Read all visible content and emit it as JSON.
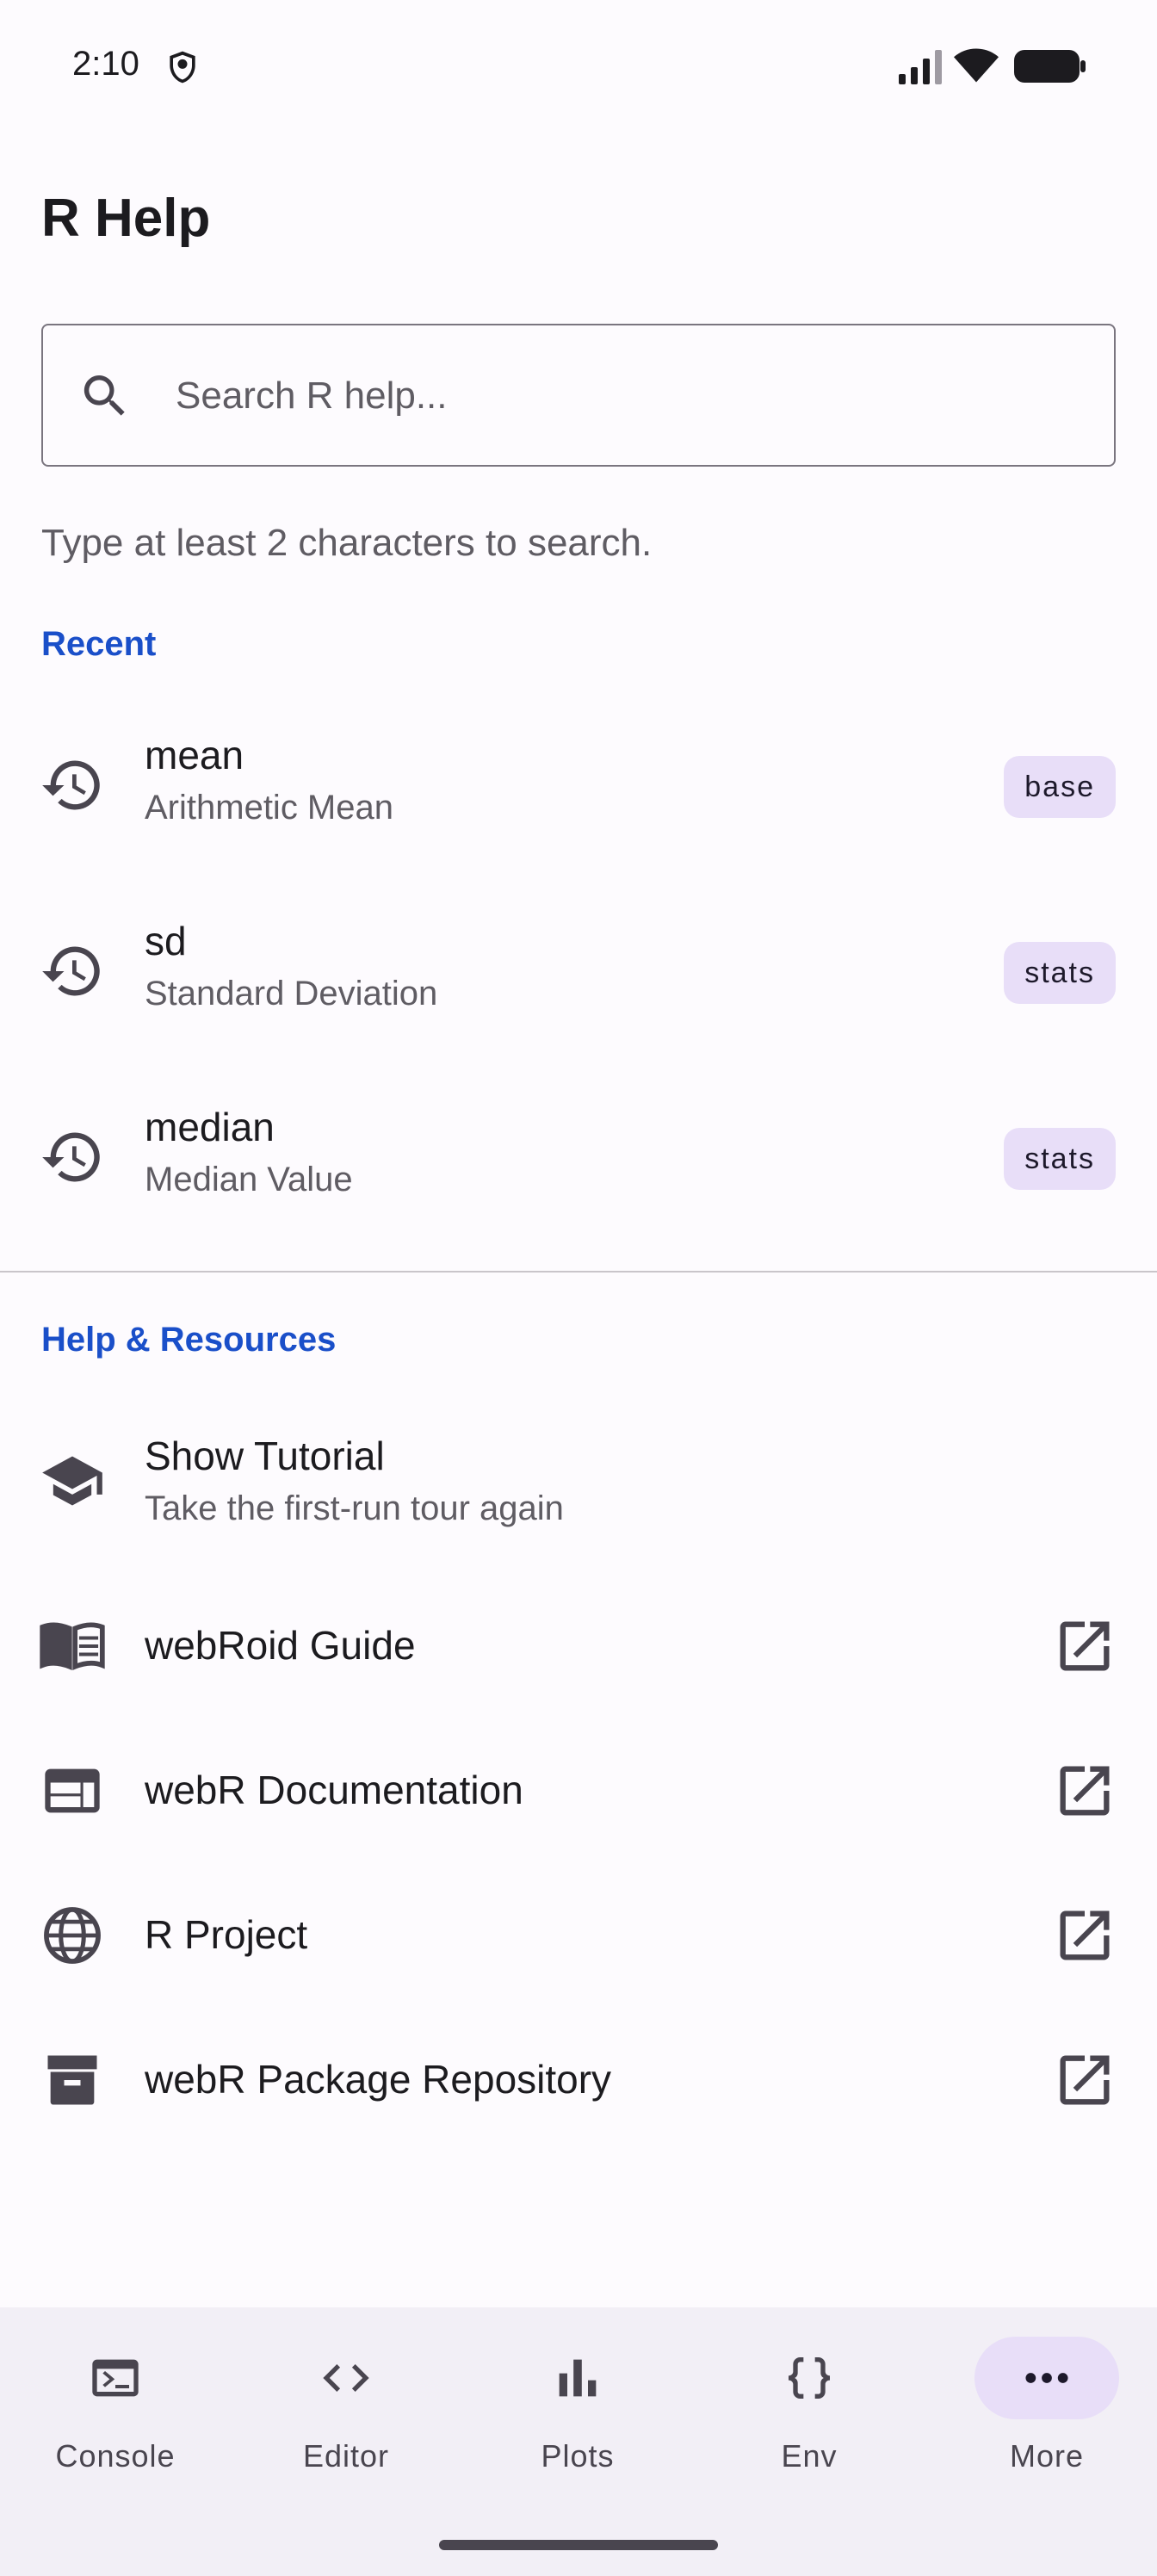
{
  "status_bar": {
    "time": "2:10",
    "icons": [
      "shield-icon",
      "signal-icon",
      "wifi-icon",
      "battery-icon"
    ]
  },
  "page_title": "R Help",
  "search": {
    "placeholder": "Search R help...",
    "value": ""
  },
  "hint": "Type at least 2 characters to search.",
  "recent": {
    "label": "Recent",
    "items": [
      {
        "title": "mean",
        "subtitle": "Arithmetic Mean",
        "package": "base",
        "icon": "history-icon"
      },
      {
        "title": "sd",
        "subtitle": "Standard Deviation",
        "package": "stats",
        "icon": "history-icon"
      },
      {
        "title": "median",
        "subtitle": "Median Value",
        "package": "stats",
        "icon": "history-icon"
      }
    ]
  },
  "resources": {
    "label": "Help & Resources",
    "items": [
      {
        "title": "Show Tutorial",
        "subtitle": "Take the first-run tour again",
        "icon": "school-icon"
      },
      {
        "title": "webRoid Guide",
        "icon": "book-icon",
        "external": true
      },
      {
        "title": "webR Documentation",
        "icon": "web-icon",
        "external": true
      },
      {
        "title": "R Project",
        "icon": "globe-icon",
        "external": true
      },
      {
        "title": "webR Package Repository",
        "icon": "archive-icon",
        "external": true
      }
    ]
  },
  "bottom_nav": {
    "items": [
      {
        "label": "Console",
        "icon": "terminal-icon",
        "active": false
      },
      {
        "label": "Editor",
        "icon": "code-icon",
        "active": false
      },
      {
        "label": "Plots",
        "icon": "bar-chart-icon",
        "active": false
      },
      {
        "label": "Env",
        "icon": "braces-icon",
        "active": false
      },
      {
        "label": "More",
        "icon": "more-horiz-icon",
        "active": true
      }
    ]
  },
  "colors": {
    "accent": "#1a4fc9",
    "badge_bg": "#e8def8",
    "nav_bg": "#f2eff6",
    "icon": "#49454f"
  }
}
